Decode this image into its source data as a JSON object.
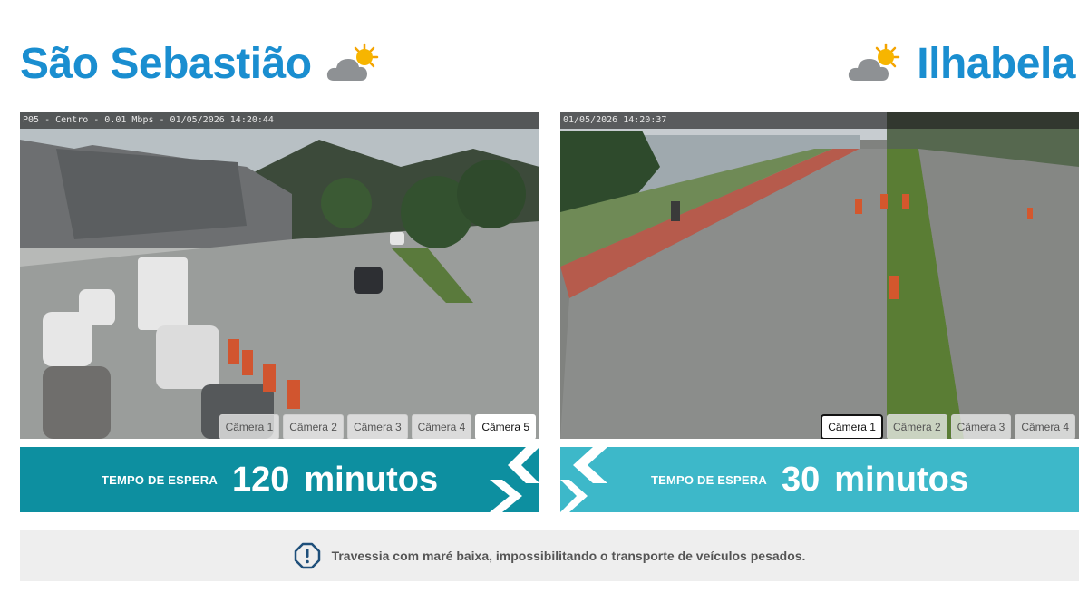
{
  "cities": {
    "left": {
      "name": "São Sebastião",
      "weather_icon": "partly-cloudy-icon"
    },
    "right": {
      "name": "Ilhabela",
      "weather_icon": "partly-cloudy-icon"
    }
  },
  "cameras": {
    "left": {
      "osd": "P05 - Centro - 0.01 Mbps - 01/05/2026 14:20:44",
      "buttons": [
        "Câmera 1",
        "Câmera 2",
        "Câmera 3",
        "Câmera 4",
        "Câmera 5"
      ],
      "selected": "Câmera 5"
    },
    "right": {
      "osd": "01/05/2026 14:20:37",
      "buttons": [
        "Câmera 1",
        "Câmera 2",
        "Câmera 3",
        "Câmera 4"
      ],
      "selected": "Câmera 1"
    }
  },
  "wait": {
    "left": {
      "label": "TEMPO DE ESPERA",
      "value": "120",
      "unit": "minutos"
    },
    "right": {
      "label": "TEMPO DE ESPERA",
      "value": "30",
      "unit": "minutos"
    }
  },
  "notice": {
    "icon": "alert-icon",
    "text": "Travessia com maré baixa, impossibilitando o transporte de veículos pesados."
  },
  "colors": {
    "title_blue": "#1a8ed0",
    "wait_left": "#0d8fa0",
    "wait_right": "#3db8c9",
    "notice_bg": "#eeeeee"
  }
}
